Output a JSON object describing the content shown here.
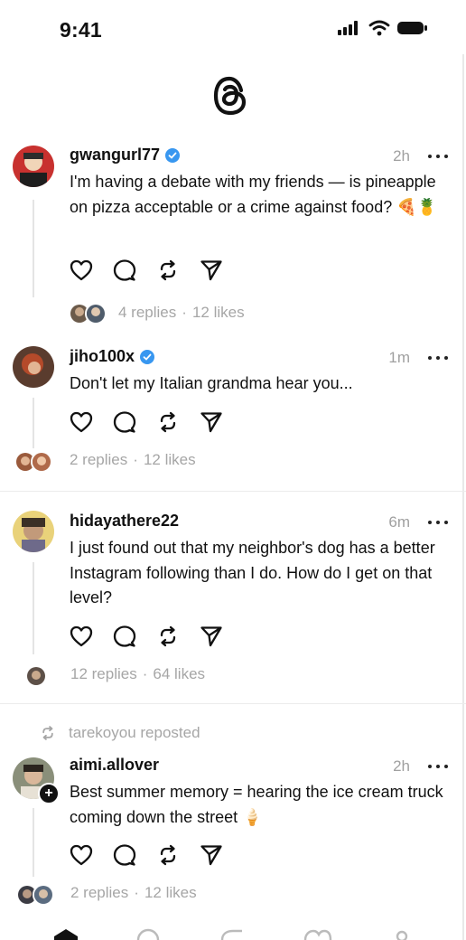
{
  "status_bar": {
    "time": "9:41"
  },
  "app": {
    "logo": "threads-logo-icon"
  },
  "posts": [
    {
      "username": "gwangurl77",
      "verified": true,
      "time": "2h",
      "text": "I'm having a debate with my friends — is pineapple on pizza acceptable or a crime against food? 🍕🍍",
      "replies": "4 replies",
      "likes": "12 likes"
    },
    {
      "username": "jiho100x",
      "verified": true,
      "time": "1m",
      "text": "Don't let my Italian grandma hear you...",
      "replies": "2 replies",
      "likes": "12 likes"
    },
    {
      "username": "hidayathere22",
      "verified": false,
      "time": "6m",
      "text": "I just found out that my neighbor's dog has a better Instagram following than I do. How do I get on that level?",
      "replies": "12 replies",
      "likes": "64 likes"
    },
    {
      "repost_label": "tarekoyou reposted",
      "username": "aimi.allover",
      "verified": false,
      "time": "2h",
      "text": "Best summer memory = hearing the ice cream truck coming down the street 🍦",
      "replies": "2 replies",
      "likes": "12 likes"
    }
  ],
  "separator": "·",
  "icons": {
    "like": "heart-icon",
    "reply": "comment-icon",
    "repost": "repost-icon",
    "share": "send-icon",
    "more": "more-icon",
    "verified": "verified-badge-icon"
  },
  "colors": {
    "verified": "#3897f0",
    "muted": "#a6a6a6",
    "text": "#111111"
  }
}
